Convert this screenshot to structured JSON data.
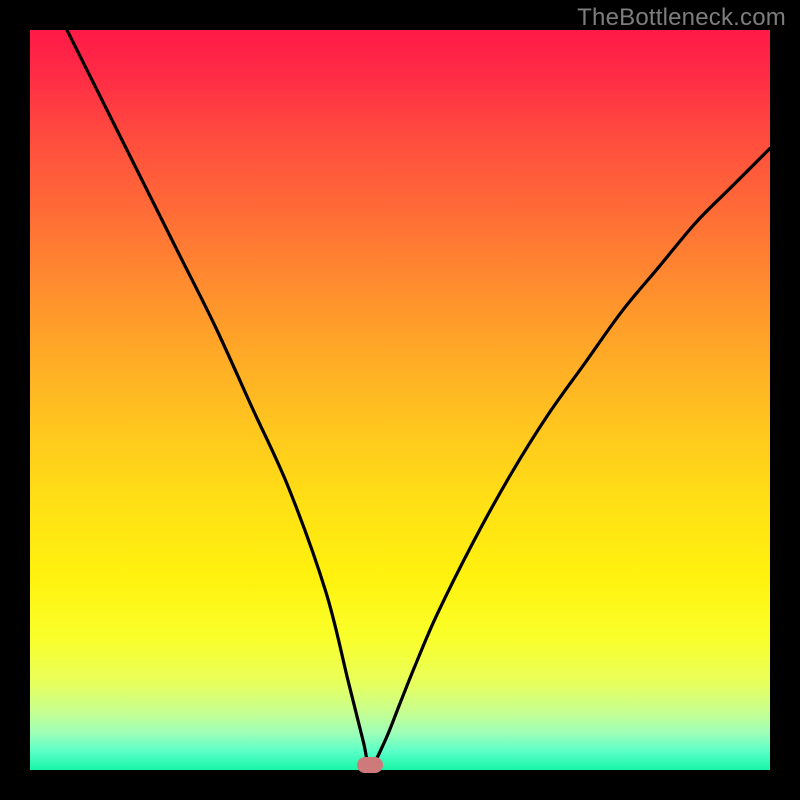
{
  "watermark": "TheBottleneck.com",
  "colors": {
    "page_bg": "#000000",
    "watermark": "#7d7d7d",
    "curve": "#000000",
    "marker": "#cf7a7a",
    "gradient_top": "#ff1a47",
    "gradient_bottom": "#17f5a8"
  },
  "chart_data": {
    "type": "line",
    "title": "",
    "xlabel": "",
    "ylabel": "",
    "xlim": [
      0,
      100
    ],
    "ylim": [
      0,
      100
    ],
    "grid": false,
    "legend": false,
    "notes": "V-shaped bottleneck curve. Values are approximate percentages along each axis read from the figure (0 = left/bottom, 100 = right/top). The curve drops from top-left to a minimum near x≈46 (y≈0) and rises toward the upper right. A small rounded marker sits at the minimum.",
    "series": [
      {
        "name": "bottleneck-curve",
        "x": [
          5,
          10,
          15,
          20,
          25,
          30,
          35,
          40,
          43,
          45,
          46,
          48,
          50,
          52,
          55,
          60,
          65,
          70,
          75,
          80,
          85,
          90,
          95,
          100
        ],
        "y": [
          100,
          90,
          80,
          70,
          60,
          49,
          38,
          24,
          12,
          4,
          0.5,
          4,
          9,
          14,
          21,
          31,
          40,
          48,
          55,
          62,
          68,
          74,
          79,
          84
        ]
      }
    ],
    "marker": {
      "x": 46,
      "y": 0.5
    }
  }
}
